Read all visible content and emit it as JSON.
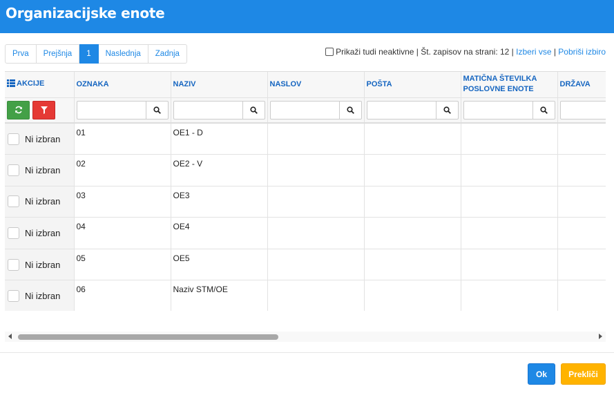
{
  "dialog": {
    "title": "Organizacijske enote"
  },
  "pager": {
    "first": "Prva",
    "prev": "Prejšnja",
    "current": "1",
    "next": "Naslednja",
    "last": "Zadnja"
  },
  "options": {
    "show_inactive": "Prikaži tudi neaktivne",
    "sep1": " | ",
    "per_page": "Št. zapisov na strani: 12",
    "sep2": " | ",
    "select_all": "Izberi vse",
    "sep3": " | ",
    "clear_selection": "Pobriši izbiro"
  },
  "columns": {
    "actions": "AKCIJE",
    "oznaka": "OZNAKA",
    "naziv": "NAZIV",
    "naslov": "NASLOV",
    "posta": "POŠTA",
    "maticna_line1": "MATIČNA ŠTEVILKA",
    "maticna_line2": "POSLOVNE ENOTE",
    "drzava": "DRŽAVA"
  },
  "rows": [
    {
      "select_label": "Ni izbran",
      "oznaka": "01",
      "naziv": "OE1 - D",
      "naslov": "",
      "posta": "",
      "maticna": "",
      "drzava": ""
    },
    {
      "select_label": "Ni izbran",
      "oznaka": "02",
      "naziv": "OE2 - V",
      "naslov": "",
      "posta": "",
      "maticna": "",
      "drzava": ""
    },
    {
      "select_label": "Ni izbran",
      "oznaka": "03",
      "naziv": "OE3",
      "naslov": "",
      "posta": "",
      "maticna": "",
      "drzava": ""
    },
    {
      "select_label": "Ni izbran",
      "oznaka": "04",
      "naziv": "OE4",
      "naslov": "",
      "posta": "",
      "maticna": "",
      "drzava": ""
    },
    {
      "select_label": "Ni izbran",
      "oznaka": "05",
      "naziv": "OE5",
      "naslov": "",
      "posta": "",
      "maticna": "",
      "drzava": ""
    },
    {
      "select_label": "Ni izbran",
      "oznaka": "06",
      "naziv": "Naziv STM/OE",
      "naslov": "",
      "posta": "",
      "maticna": "",
      "drzava": ""
    }
  ],
  "buttons": {
    "ok": "Ok",
    "cancel": "Prekliči"
  },
  "icons": {
    "list": "list-icon",
    "refresh": "refresh-icon",
    "filter": "filter-icon",
    "search": "search-icon"
  },
  "colors": {
    "header": "#1e88e5",
    "link": "#1e88e5",
    "refresh_button": "#43a047",
    "filter_button": "#e53935",
    "cancel_button": "#ffb300"
  }
}
